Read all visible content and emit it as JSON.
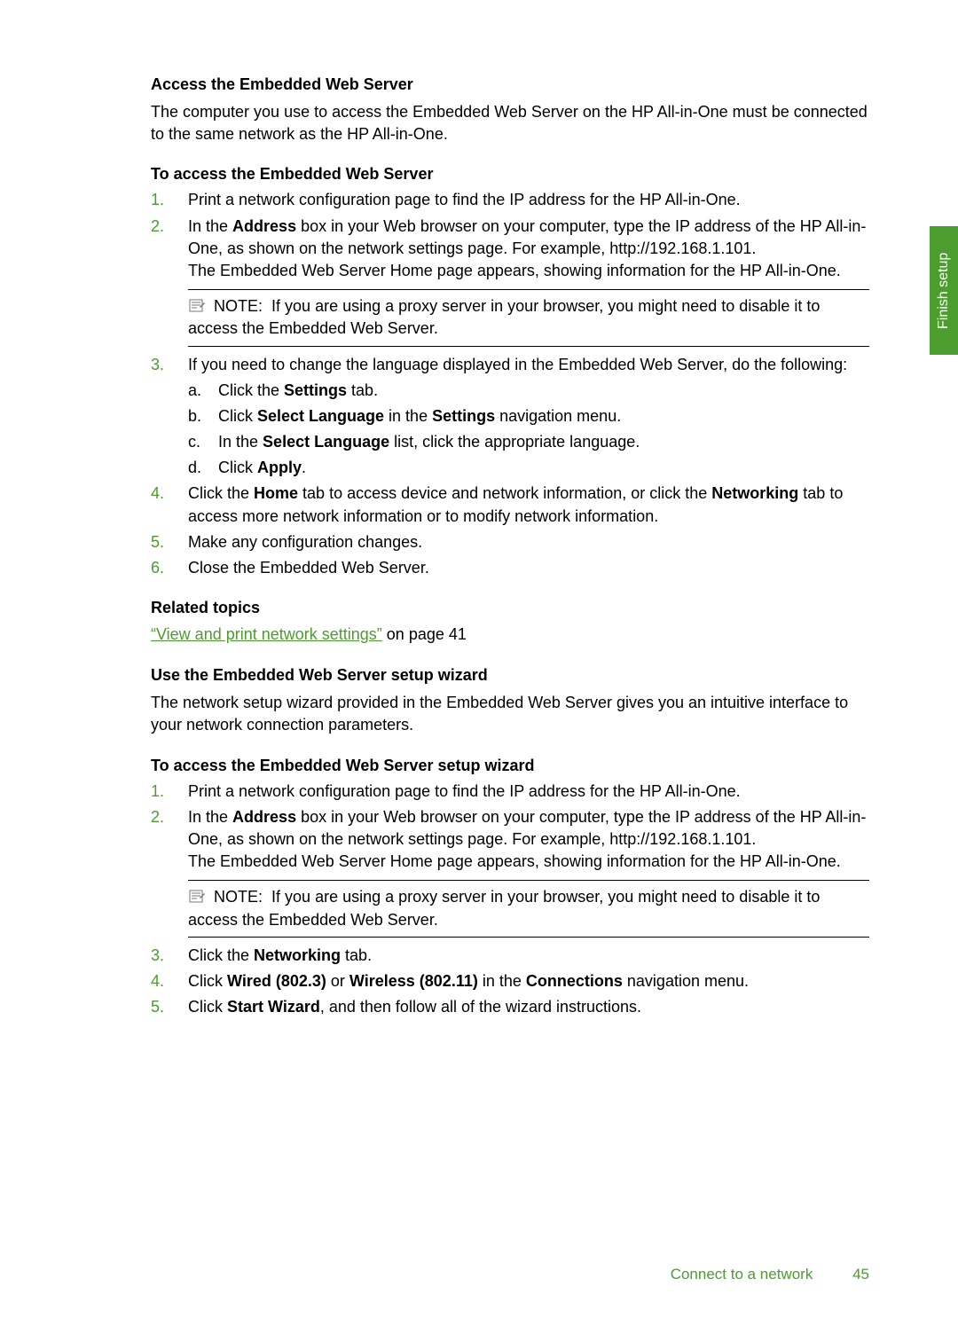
{
  "side_tab": "Finish setup",
  "section1": {
    "heading": "Access the Embedded Web Server",
    "intro": "The computer you use to access the Embedded Web Server on the HP All-in-One must be connected to the same network as the HP All-in-One.",
    "list_heading": "To access the Embedded Web Server",
    "items": {
      "i1": "Print a network configuration page to find the IP address for the HP All-in-One.",
      "i2_pre": "In the ",
      "i2_b1": "Address",
      "i2_mid": " box in your Web browser on your computer, type the IP address of the HP All-in-One, as shown on the network settings page. For example, http://192.168.1.101.",
      "i2_p2": "The Embedded Web Server Home page appears, showing information for the HP All-in-One.",
      "note_label": "NOTE:",
      "note_text": "If you are using a proxy server in your browser, you might need to disable it to access the Embedded Web Server.",
      "i3": "If you need to change the language displayed in the Embedded Web Server, do the following:",
      "sub": {
        "a_pre": "Click the ",
        "a_b": "Settings",
        "a_post": " tab.",
        "b_pre": "Click ",
        "b_b1": "Select Language",
        "b_mid": " in the ",
        "b_b2": "Settings",
        "b_post": " navigation menu.",
        "c_pre": "In the ",
        "c_b": "Select Language",
        "c_post": " list, click the appropriate language.",
        "d_pre": "Click ",
        "d_b": "Apply",
        "d_post": "."
      },
      "i4_pre": "Click the ",
      "i4_b1": "Home",
      "i4_mid": " tab to access device and network information, or click the ",
      "i4_b2": "Networking",
      "i4_post": " tab to access more network information or to modify network information.",
      "i5": "Make any configuration changes.",
      "i6": "Close the Embedded Web Server."
    },
    "related_heading": "Related topics",
    "related_link": "“View and print network settings”",
    "related_page": " on page 41"
  },
  "section2": {
    "heading": "Use the Embedded Web Server setup wizard",
    "intro": "The network setup wizard provided in the Embedded Web Server gives you an intuitive interface to your network connection parameters.",
    "list_heading": "To access the Embedded Web Server setup wizard",
    "items": {
      "i1": "Print a network configuration page to find the IP address for the HP All-in-One.",
      "i2_pre": "In the ",
      "i2_b1": "Address",
      "i2_mid": " box in your Web browser on your computer, type the IP address of the HP All-in-One, as shown on the network settings page. For example, http://192.168.1.101.",
      "i2_p2": "The Embedded Web Server Home page appears, showing information for the HP All-in-One.",
      "note_label": "NOTE:",
      "note_text": "If you are using a proxy server in your browser, you might need to disable it to access the Embedded Web Server.",
      "i3_pre": "Click the ",
      "i3_b": "Networking",
      "i3_post": " tab.",
      "i4_pre": "Click ",
      "i4_b1": "Wired (802.3)",
      "i4_mid": " or ",
      "i4_b2": "Wireless (802.11)",
      "i4_mid2": " in the ",
      "i4_b3": "Connections",
      "i4_post": " navigation menu.",
      "i5_pre": "Click ",
      "i5_b": "Start Wizard",
      "i5_post": ", and then follow all of the wizard instructions."
    }
  },
  "footer": {
    "section": "Connect to a network",
    "page": "45"
  }
}
